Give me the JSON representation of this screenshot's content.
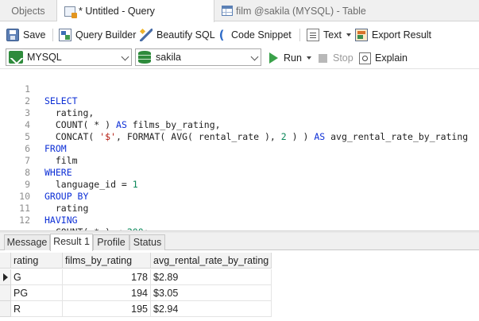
{
  "tabs": {
    "objects": "Objects",
    "query": "* Untitled - Query",
    "table": "film @sakila (MYSQL) - Table"
  },
  "toolbar": {
    "save": "Save",
    "query_builder": "Query Builder",
    "beautify": "Beautify SQL",
    "snippet": "Code Snippet",
    "text": "Text",
    "export": "Export Result"
  },
  "connection": {
    "server": "MYSQL",
    "database": "sakila",
    "run": "Run",
    "stop": "Stop",
    "explain": "Explain"
  },
  "editor": {
    "line_numbers": [
      "1",
      "2",
      "3",
      "4",
      "5",
      "6",
      "7",
      "8",
      "9",
      "10",
      "11",
      "12"
    ]
  },
  "result_tabs": {
    "message": "Message",
    "result": "Result 1",
    "profile": "Profile",
    "status": "Status"
  },
  "grid": {
    "columns": [
      "rating",
      "films_by_rating",
      "avg_rental_rate_by_rating"
    ],
    "rows": [
      {
        "rating": "G",
        "films": "178",
        "avg": "$2.89"
      },
      {
        "rating": "PG",
        "films": "194",
        "avg": "$3.05"
      },
      {
        "rating": "R",
        "films": "195",
        "avg": "$2.94"
      }
    ]
  },
  "colors": {
    "keyword": "#0d2fd6",
    "string": "#b3180d",
    "number": "#098658",
    "run_green": "#3aa14a"
  }
}
